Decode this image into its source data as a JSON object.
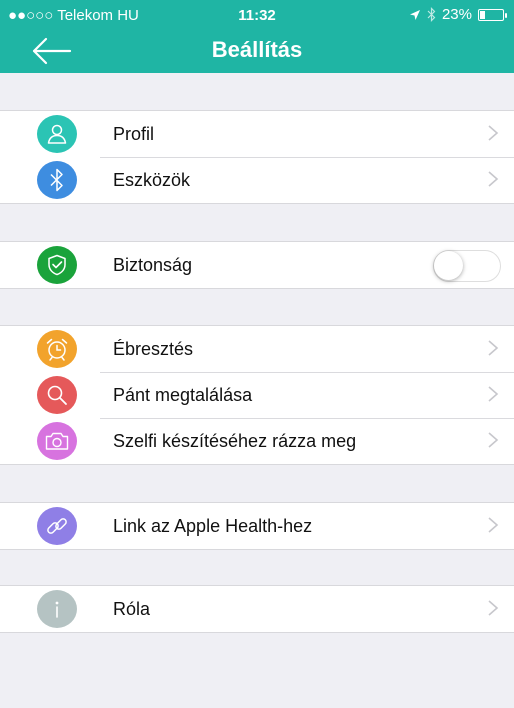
{
  "status_bar": {
    "carrier": "●●○○○ Telekom HU",
    "time": "11:32",
    "battery": "23%",
    "battery_level": 0.23
  },
  "navbar": {
    "title": "Beállítás"
  },
  "groups": [
    {
      "items": [
        {
          "label": "Profil",
          "icon": "person-icon",
          "color": "#2bc4b4"
        },
        {
          "label": "Eszközök",
          "icon": "bluetooth-icon",
          "color": "#3e8de0"
        }
      ]
    },
    {
      "items": [
        {
          "label": "Biztonság",
          "icon": "shield-check-icon",
          "color": "#1aa33b",
          "toggle": false
        }
      ]
    },
    {
      "items": [
        {
          "label": "Ébresztés",
          "icon": "alarm-clock-icon",
          "color": "#f2a32c"
        },
        {
          "label": "Pánt megtalálása",
          "icon": "magnifier-icon",
          "color": "#e5595a"
        },
        {
          "label": "Szelfi készítéséhez rázza meg",
          "icon": "camera-icon",
          "color": "#d773df"
        }
      ]
    },
    {
      "items": [
        {
          "label": "Link az Apple Health-hez",
          "icon": "link-icon",
          "color": "#8f7fe6"
        }
      ]
    },
    {
      "items": [
        {
          "label": "Róla",
          "icon": "info-icon",
          "color": "#b5c3c3"
        }
      ]
    }
  ]
}
